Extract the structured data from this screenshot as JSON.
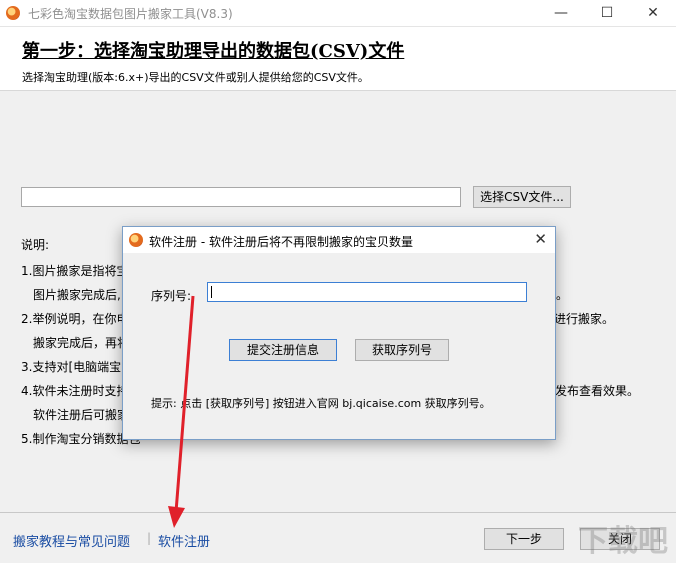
{
  "window": {
    "title": "七彩色淘宝数据包图片搬家工具(V8.3)",
    "minimize": "—",
    "maximize": "☐",
    "close": "✕"
  },
  "header": {
    "step_title": "第一步：选择淘宝助理导出的数据包(CSV)文件",
    "step_desc": "选择淘宝助理(版本:6.x+)导出的CSV文件或别人提供给您的CSV文件。"
  },
  "csv": {
    "path_value": "",
    "select_button": "选择CSV文件..."
  },
  "info": {
    "heading": "说明:",
    "lines": [
      "1.图片搬家是指将宝",
      "图片搬家完成后,",
      "2.举例说明，在你电",
      "搬家完成后，再将",
      "3.支持对[电脑端宝",
      "4.软件未注册时支持",
      "软件注册后可搬家",
      "5.制作淘宝分销数据包"
    ],
    "right_fragments": [
      "。",
      "进行搬家。",
      "发布查看效果。"
    ]
  },
  "bottom": {
    "tutorial_link": "搬家教程与常见问题",
    "separator": "|",
    "register_link": "软件注册",
    "next_button": "下一步",
    "close_button": "关闭"
  },
  "dialog": {
    "title": "软件注册 - 软件注册后将不再限制搬家的宝贝数量",
    "close": "✕",
    "serial_label": "序列号:",
    "serial_value": "",
    "submit_button": "提交注册信息",
    "get_serial_button": "获取序列号",
    "hint": "提示: 点击 [获取序列号] 按钮进入官网 bj.qicaise.com 获取序列号。"
  },
  "watermark": "下载吧",
  "colors": {
    "link": "#1a4da3",
    "arrow": "#e0202a",
    "dialog_border": "#7a9ec7"
  }
}
